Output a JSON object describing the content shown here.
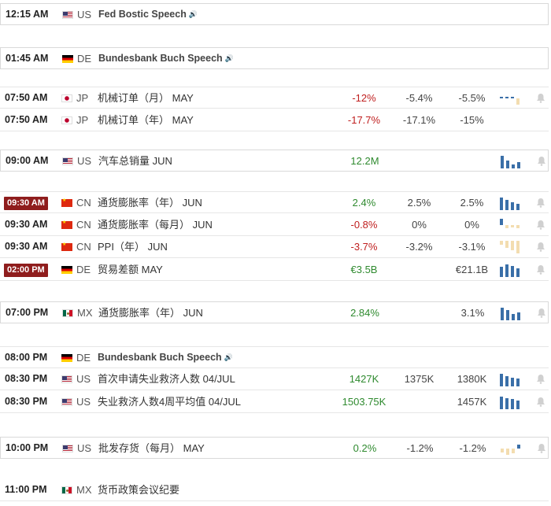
{
  "rows": [
    {
      "time": "12:15 AM",
      "badge": false,
      "flag": "us",
      "country": "US",
      "event": "Fed Bostic Speech",
      "speech": true,
      "actual": "",
      "actual_tone": "",
      "forecast": "",
      "previous": "",
      "spark": null,
      "bell": false
    },
    {
      "time": "01:45 AM",
      "badge": false,
      "flag": "de",
      "country": "DE",
      "event": "Bundesbank Buch Speech",
      "speech": true,
      "actual": "",
      "actual_tone": "",
      "forecast": "",
      "previous": "",
      "spark": null,
      "bell": false
    },
    {
      "time": "07:50 AM",
      "badge": false,
      "flag": "jp",
      "country": "JP",
      "event": "机械订单（月） MAY",
      "speech": false,
      "actual": "-12%",
      "actual_tone": "neg",
      "forecast": "-5.4%",
      "previous": "-5.5%",
      "spark": [
        1,
        1,
        1,
        -6
      ],
      "bell": true
    },
    {
      "time": "07:50 AM",
      "badge": false,
      "flag": "jp",
      "country": "JP",
      "event": "机械订单（年） MAY",
      "speech": false,
      "actual": "-17.7%",
      "actual_tone": "neg",
      "forecast": "-17.1%",
      "previous": "-15%",
      "spark": null,
      "bell": false
    },
    {
      "time": "09:00 AM",
      "badge": false,
      "flag": "us",
      "country": "US",
      "event": "汽车总销量 JUN",
      "speech": false,
      "actual": "12.2M",
      "actual_tone": "pos",
      "forecast": "",
      "previous": "",
      "spark": [
        10,
        6,
        3,
        5
      ],
      "bell": true
    },
    {
      "time": "09:30 AM",
      "badge": true,
      "flag": "cn",
      "country": "CN",
      "event": "通货膨胀率（年） JUN",
      "speech": false,
      "actual": "2.4%",
      "actual_tone": "pos",
      "forecast": "2.5%",
      "previous": "2.5%",
      "spark": [
        10,
        8,
        6,
        5
      ],
      "bell": true
    },
    {
      "time": "09:30 AM",
      "badge": false,
      "flag": "cn",
      "country": "CN",
      "event": "通货膨胀率（每月） JUN",
      "speech": false,
      "actual": "-0.8%",
      "actual_tone": "neg",
      "forecast": "0%",
      "previous": "0%",
      "spark": [
        8,
        -4,
        -3,
        -4
      ],
      "bell": true
    },
    {
      "time": "09:30 AM",
      "badge": false,
      "flag": "cn",
      "country": "CN",
      "event": "PPI（年） JUN",
      "speech": false,
      "actual": "-3.7%",
      "actual_tone": "neg",
      "forecast": "-3.2%",
      "previous": "-3.1%",
      "spark": [
        -3,
        -5,
        -7,
        -9
      ],
      "bell": true
    },
    {
      "time": "02:00 PM",
      "badge": true,
      "flag": "de",
      "country": "DE",
      "event": "贸易差额 MAY",
      "speech": false,
      "actual": "€3.5B",
      "actual_tone": "pos",
      "forecast": "",
      "previous": "€21.1B",
      "spark": [
        8,
        10,
        9,
        7
      ],
      "bell": true
    },
    {
      "time": "07:00 PM",
      "badge": false,
      "flag": "mx",
      "country": "MX",
      "event": "通货膨胀率（年） JUN",
      "speech": false,
      "actual": "2.84%",
      "actual_tone": "pos",
      "forecast": "",
      "previous": "3.1%",
      "spark": [
        10,
        8,
        5,
        6
      ],
      "bell": true
    },
    {
      "time": "08:00 PM",
      "badge": false,
      "flag": "de",
      "country": "DE",
      "event": "Bundesbank Buch Speech",
      "speech": true,
      "actual": "",
      "actual_tone": "",
      "forecast": "",
      "previous": "",
      "spark": null,
      "bell": false
    },
    {
      "time": "08:30 PM",
      "badge": false,
      "flag": "us",
      "country": "US",
      "event": "首次申请失业救济人数 04/JUL",
      "speech": false,
      "actual": "1427K",
      "actual_tone": "pos",
      "forecast": "1375K",
      "previous": "1380K",
      "spark": [
        10,
        8,
        7,
        6
      ],
      "bell": true
    },
    {
      "time": "08:30 PM",
      "badge": false,
      "flag": "us",
      "country": "US",
      "event": "失业救济人数4周平均值 04/JUL",
      "speech": false,
      "actual": "1503.75K",
      "actual_tone": "pos",
      "forecast": "",
      "previous": "1457K",
      "spark": [
        10,
        9,
        8,
        7
      ],
      "bell": true
    },
    {
      "time": "10:00 PM",
      "badge": false,
      "flag": "us",
      "country": "US",
      "event": "批发存货（每月） MAY",
      "speech": false,
      "actual": "0.2%",
      "actual_tone": "pos",
      "forecast": "-1.2%",
      "previous": "-1.2%",
      "spark": [
        -3,
        -5,
        -4,
        3
      ],
      "bell": true
    },
    {
      "time": "11:00 PM",
      "badge": false,
      "flag": "mx",
      "country": "MX",
      "event": "货币政策会议纪要",
      "speech": false,
      "actual": "",
      "actual_tone": "",
      "forecast": "",
      "previous": "",
      "spark": null,
      "bell": false
    }
  ],
  "icons": {
    "speech": "speaker-icon",
    "alert": "bell-icon"
  },
  "colors": {
    "negative": "#c02020",
    "positive": "#2f8a2f",
    "badge": "#8f1d1d",
    "spark_up": "#3a6fa8",
    "spark_down": "#f3ddb0"
  }
}
